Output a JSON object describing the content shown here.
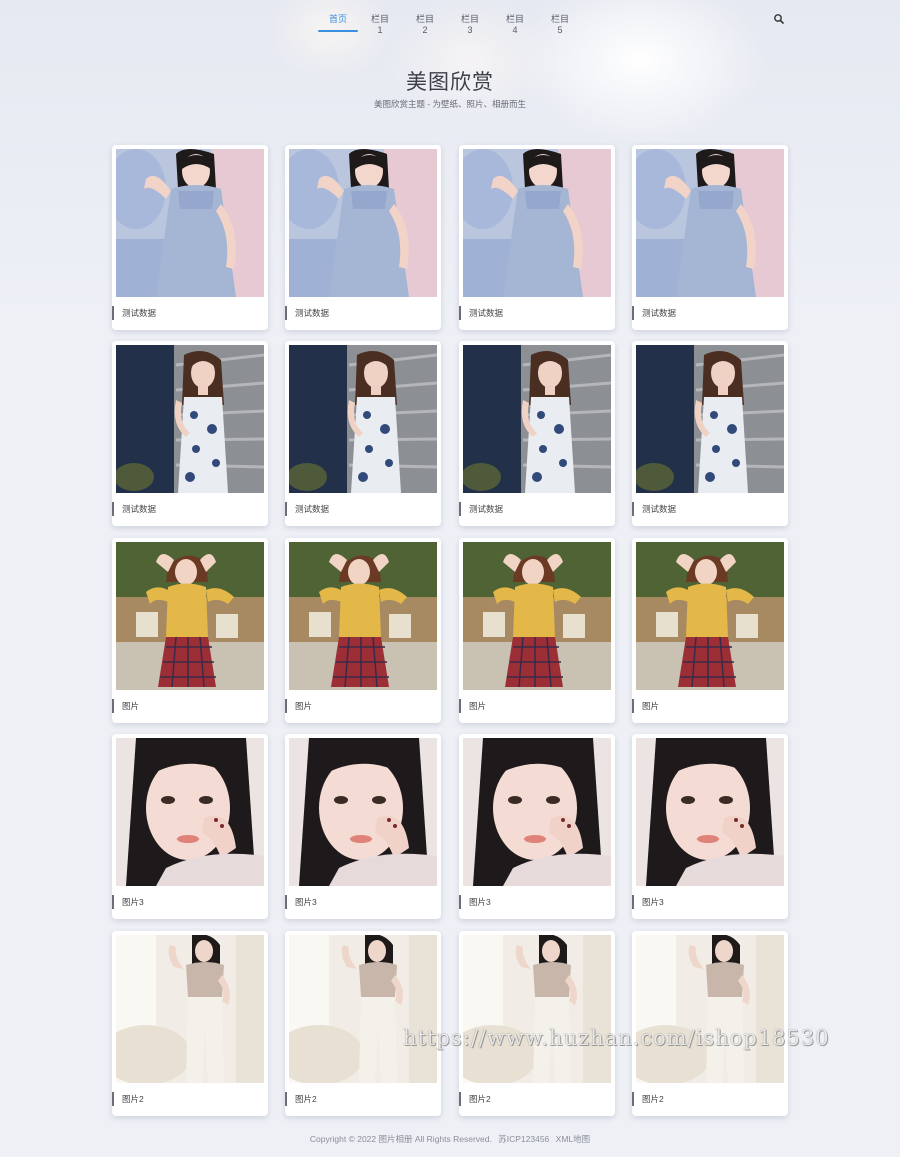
{
  "nav": {
    "items": [
      {
        "label": "首页",
        "active": true
      },
      {
        "label": "栏目1",
        "active": false
      },
      {
        "label": "栏目2",
        "active": false
      },
      {
        "label": "栏目3",
        "active": false
      },
      {
        "label": "栏目4",
        "active": false
      },
      {
        "label": "栏目5",
        "active": false
      }
    ],
    "search_icon": "search-icon"
  },
  "hero": {
    "title": "美图欣赏",
    "subtitle": "美图欣赏主题 - 为壁纸、照片、相册而生"
  },
  "rows": [
    {
      "photo": "woman-blue-knit-sweater",
      "cards": [
        {
          "caption": "测试数据"
        },
        {
          "caption": "测试数据"
        },
        {
          "caption": "测试数据"
        },
        {
          "caption": "测试数据"
        }
      ]
    },
    {
      "photo": "woman-floral-dress",
      "cards": [
        {
          "caption": "测试数据"
        },
        {
          "caption": "测试数据"
        },
        {
          "caption": "测试数据"
        },
        {
          "caption": "测试数据"
        }
      ]
    },
    {
      "photo": "woman-yellow-top-plaid-skirt",
      "cards": [
        {
          "caption": "图片"
        },
        {
          "caption": "图片"
        },
        {
          "caption": "图片"
        },
        {
          "caption": "图片"
        }
      ]
    },
    {
      "photo": "woman-portrait-closeup",
      "cards": [
        {
          "caption": "图片3"
        },
        {
          "caption": "图片3"
        },
        {
          "caption": "图片3"
        },
        {
          "caption": "图片3"
        }
      ]
    },
    {
      "photo": "woman-white-outfit",
      "cards": [
        {
          "caption": "图片2"
        },
        {
          "caption": "图片2"
        },
        {
          "caption": "图片2"
        },
        {
          "caption": "图片2"
        }
      ]
    }
  ],
  "footer": {
    "copyright": "Copyright © 2022 图片相册 All Rights Reserved.",
    "icp": "苏ICP123456",
    "sitemap": "XML地图"
  },
  "watermark": "https://www.huzhan.com/ishop18530",
  "colors": {
    "accent": "#3a8fe0",
    "background": "#eef0f6"
  }
}
